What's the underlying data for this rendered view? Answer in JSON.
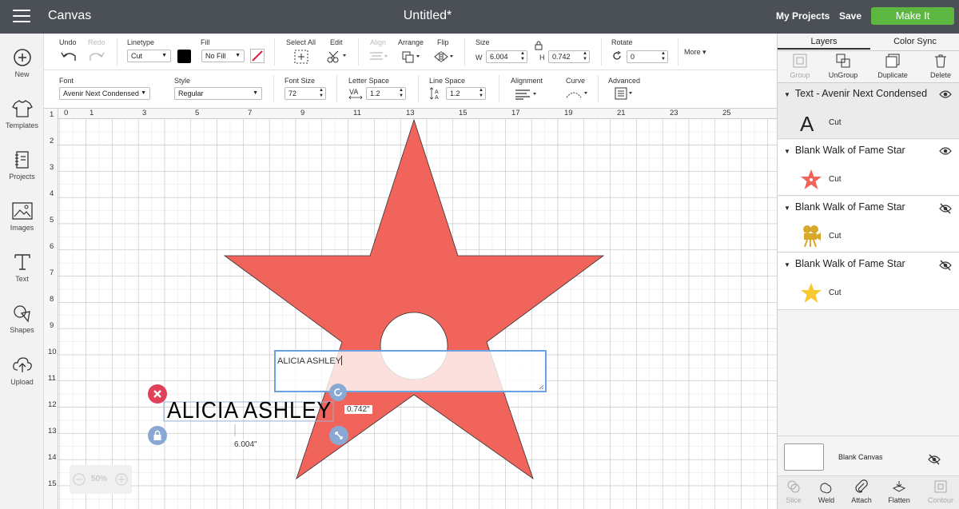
{
  "topbar": {
    "app_title": "Canvas",
    "doc_title": "Untitled*",
    "my_projects": "My Projects",
    "save": "Save",
    "make_it": "Make It"
  },
  "sidebar": {
    "items": [
      {
        "label": "New",
        "icon": "plus-circle-icon"
      },
      {
        "label": "Templates",
        "icon": "tshirt-icon"
      },
      {
        "label": "Projects",
        "icon": "notebook-icon"
      },
      {
        "label": "Images",
        "icon": "image-icon"
      },
      {
        "label": "Text",
        "icon": "text-t-icon"
      },
      {
        "label": "Shapes",
        "icon": "shapes-icon"
      },
      {
        "label": "Upload",
        "icon": "cloud-upload-icon"
      }
    ]
  },
  "toolbar": {
    "undo": "Undo",
    "redo": "Redo",
    "linetype_label": "Linetype",
    "linetype_value": "Cut",
    "fill_label": "Fill",
    "fill_value": "No Fill",
    "select_all": "Select All",
    "edit": "Edit",
    "align": "Align",
    "arrange": "Arrange",
    "flip": "Flip",
    "size_label": "Size",
    "w_label": "W",
    "w_value": "6.004",
    "h_label": "H",
    "h_value": "0.742",
    "rotate_label": "Rotate",
    "rotate_value": "0",
    "more": "More",
    "font_label": "Font",
    "font_value": "Avenir Next Condensed",
    "style_label": "Style",
    "style_value": "Regular",
    "font_size_label": "Font Size",
    "font_size_value": "72",
    "letter_space_label": "Letter Space",
    "letter_space_value": "1.2",
    "line_space_label": "Line Space",
    "line_space_value": "1.2",
    "alignment_label": "Alignment",
    "curve_label": "Curve",
    "advanced_label": "Advanced"
  },
  "layers": {
    "tab_layers": "Layers",
    "tab_color_sync": "Color Sync",
    "buttons": {
      "group": "Group",
      "ungroup": "UnGroup",
      "duplicate": "Duplicate",
      "delete": "Delete"
    },
    "groups": [
      {
        "title": "Text - Avenir Next Condensed",
        "sub": "Cut",
        "visible": true,
        "thumb": "A"
      },
      {
        "title": "Blank Walk of Fame Star",
        "sub": "Cut",
        "visible": true,
        "thumb": "star-red"
      },
      {
        "title": "Blank Walk of Fame Star",
        "sub": "Cut",
        "visible": false,
        "thumb": "camera-gold"
      },
      {
        "title": "Blank Walk of Fame Star",
        "sub": "Cut",
        "visible": false,
        "thumb": "star-yellow"
      }
    ],
    "blank_canvas": "Blank Canvas",
    "bottom": {
      "slice": "Slice",
      "weld": "Weld",
      "attach": "Attach",
      "flatten": "Flatten",
      "contour": "Contour"
    }
  },
  "canvas": {
    "ruler_top": [
      "0",
      "1",
      "3",
      "5",
      "7",
      "9",
      "11",
      "13",
      "15",
      "17",
      "19",
      "21",
      "23",
      "25"
    ],
    "ruler_left": [
      "1",
      "2",
      "3",
      "4",
      "5",
      "6",
      "7",
      "8",
      "9",
      "10",
      "11",
      "12",
      "13",
      "14",
      "15"
    ],
    "textbox_value": "ALICIA ASHLEY",
    "text_object": "ALICIA  ASHLEY",
    "height_readout": "0.742\"",
    "width_readout": "6.004\"",
    "zoom": "50%",
    "zoom_minus": "−",
    "zoom_plus": "+"
  },
  "colors": {
    "topbar": "#4b5057",
    "make_it": "#5db740",
    "star": "#f0645c",
    "selection": "#6aa2e3",
    "handle_delete": "#e0405a",
    "handle_blue": "#8aa8d4",
    "gold": "#d9a829",
    "yellow": "#f7c934"
  }
}
